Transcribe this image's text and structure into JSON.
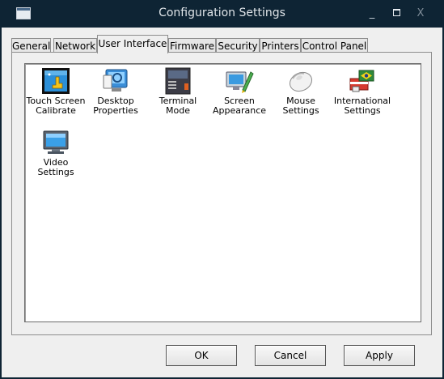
{
  "window": {
    "title": "Configuration Settings",
    "minimize_glyph": "_",
    "close_glyph": "X"
  },
  "tabs": [
    {
      "label": "General"
    },
    {
      "label": "Network"
    },
    {
      "label": "User Interface",
      "active": true
    },
    {
      "label": "Firmware"
    },
    {
      "label": "Security"
    },
    {
      "label": "Printers"
    },
    {
      "label": "Control Panel"
    }
  ],
  "items": [
    {
      "label": "Touch Screen Calibrate",
      "line1": "Touch Screen",
      "line2": "Calibrate",
      "icon": "touch-screen-icon"
    },
    {
      "label": "Desktop Properties",
      "line1": "Desktop",
      "line2": "Properties",
      "icon": "desktop-properties-icon"
    },
    {
      "label": "Terminal Mode",
      "line1": "Terminal Mode",
      "line2": "",
      "icon": "terminal-mode-icon"
    },
    {
      "label": "Screen Appearance",
      "line1": "Screen",
      "line2": "Appearance",
      "icon": "screen-appearance-icon"
    },
    {
      "label": "Mouse Settings",
      "line1": "Mouse",
      "line2": "Settings",
      "icon": "mouse-icon"
    },
    {
      "label": "International Settings",
      "line1": "International",
      "line2": "Settings",
      "icon": "international-icon"
    },
    {
      "label": "Video Settings",
      "line1": "Video Settings",
      "line2": "",
      "icon": "video-settings-icon"
    }
  ],
  "buttons": {
    "ok": "OK",
    "cancel": "Cancel",
    "apply": "Apply"
  },
  "colors": {
    "titlebar": "#0e2434",
    "dialog": "#efefef",
    "content": "#ffffff",
    "accent": "#1a7fc8"
  }
}
